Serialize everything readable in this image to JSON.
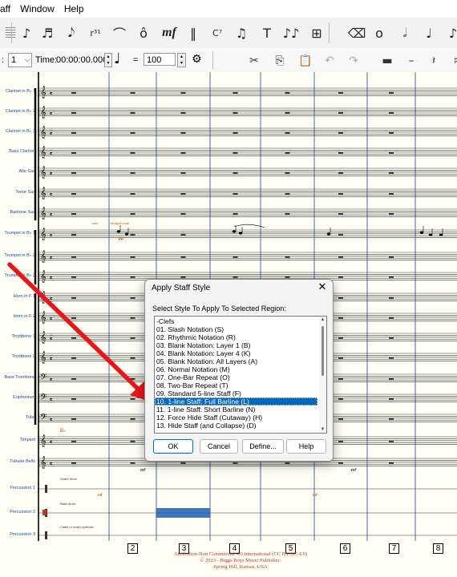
{
  "menu": [
    "aff",
    "Window",
    "Help"
  ],
  "toolbar_icons": [
    {
      "name": "staff-tool-icon",
      "glyph": "𝄚"
    },
    {
      "name": "simple-entry-icon",
      "glyph": "♪"
    },
    {
      "name": "speedy-entry-icon",
      "glyph": "♬"
    },
    {
      "name": "tuplet-tool-icon",
      "glyph": "𝅘𝅥𝅮"
    },
    {
      "name": "chord-tool-icon",
      "glyph": "r³¹"
    },
    {
      "name": "smart-shape-icon",
      "glyph": "⌒"
    },
    {
      "name": "articulation-tool-icon",
      "glyph": "ô"
    },
    {
      "name": "expression-tool-icon",
      "glyph": "mf"
    },
    {
      "name": "repeat-tool-icon",
      "glyph": "‖"
    },
    {
      "name": "chord-symbol-icon",
      "glyph": "C⁷"
    },
    {
      "name": "lyrics-tool-icon",
      "glyph": "♫"
    },
    {
      "name": "text-tool-icon",
      "glyph": "T"
    },
    {
      "name": "mirror-tool-icon",
      "glyph": "♪♪"
    },
    {
      "name": "ossia-tool-icon",
      "glyph": "⊞"
    },
    {
      "name": "eraser-icon",
      "glyph": "⌫"
    },
    {
      "name": "whole-note-icon",
      "glyph": "o"
    },
    {
      "name": "half-note-icon",
      "glyph": "𝅗𝅥"
    },
    {
      "name": "quarter-note-icon",
      "glyph": "♩"
    },
    {
      "name": "eighth-note-icon",
      "glyph": "♪"
    }
  ],
  "playback": {
    "measure_label": ":",
    "measure_value": "1",
    "time_label": "Time:",
    "time_value": "00:00:00.000",
    "equals": "=",
    "tempo": "100"
  },
  "toolbar2_icons": [
    {
      "name": "cut-icon",
      "glyph": "✂",
      "disabled": false
    },
    {
      "name": "copy-icon",
      "glyph": "⎘",
      "disabled": false
    },
    {
      "name": "paste-icon",
      "glyph": "📋",
      "disabled": true
    },
    {
      "name": "undo-icon",
      "glyph": "↶",
      "disabled": true
    },
    {
      "name": "redo-icon",
      "glyph": "↷",
      "disabled": true
    },
    {
      "name": "accent-icon",
      "glyph": "▬",
      "disabled": false
    },
    {
      "name": "tenuto-icon",
      "glyph": "–",
      "disabled": false
    },
    {
      "name": "rest-icon",
      "glyph": "𝄽",
      "disabled": false
    },
    {
      "name": "sharp-icon",
      "glyph": "♯",
      "disabled": false
    }
  ],
  "instruments": [
    "Clarinet in B♭ 1",
    "Clarinet in B♭ 2",
    "Clarinet in B♭ 3",
    "Bass Clarinet",
    "Alto Sax",
    "Tenor Sax",
    "Baritone Sax",
    "Trumpet in B♭ 1",
    "Trumpet in B♭ 2",
    "Trumpet in B♭ 3",
    "Horn in F 1",
    "Horn in F 2",
    "Trombone 1",
    "Trombone 2",
    "Bass Trombone",
    "Euphonium",
    "Tuba",
    "Timpani",
    "Tubular Bells",
    "Percussion 1",
    "Percussion 2",
    "Percussion 3"
  ],
  "score_text": {
    "solo": "solo",
    "straight_mute": "straight mute",
    "dynamic_p": "pp",
    "bflat": "B♭",
    "snare_drum": "Snare drum",
    "bass_drum": "Bass drum",
    "cymbals": "Clash or crash cymbals",
    "mf": "mf"
  },
  "measure_numbers": [
    "2",
    "3",
    "4",
    "5",
    "6",
    "7",
    "8"
  ],
  "copyright": [
    "Attribution-Non Commercial 4.0 International (CC BY-NC 4.0)",
    "© 2023 - Biggs Boys Music Publisher-",
    "Spring Hill, Kansas, USA"
  ],
  "dialog": {
    "title": "Apply Staff Style",
    "close_glyph": "✕",
    "prompt": "Select Style To Apply To Selected Region:",
    "items": [
      "-Clefs",
      "01.  Slash Notation (S)",
      "02.  Rhythmic Notation (R)",
      "03.  Blank Notation:  Layer 1 (B)",
      "04.  Blank Notation:  Layer 4 (K)",
      "05.  Blank Notation:  All Layers (A)",
      "06.  Normal Notation (M)",
      "07.  One-Bar Repeat (O)",
      "08.  Two-Bar Repeat (T)",
      "09.  Standard 5-line Staff (F)",
      "10.  1-line Staff:  Full Barline (L)",
      "11.  1-line Staff:  Short Barline (N)",
      "12.  Force Hide Staff (Cutaway) (H)",
      "13.  Hide Staff (and Collapse) (D)"
    ],
    "selected_index": 10,
    "buttons": {
      "ok": "OK",
      "cancel": "Cancel",
      "define": "Define...",
      "help": "Help"
    }
  },
  "colors": {
    "arrow": "#e8161b",
    "selection": "#0067c0",
    "barline": "#1f3f9f",
    "score_bg": "#fffff4"
  }
}
